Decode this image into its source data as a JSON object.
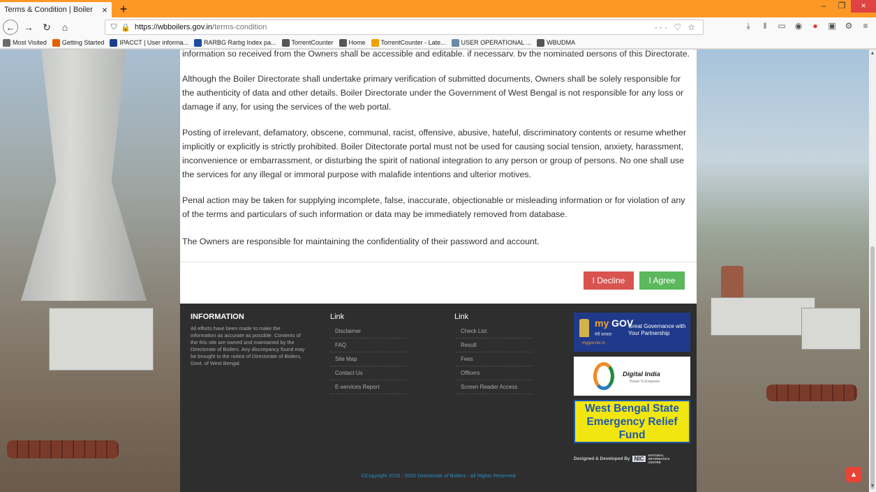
{
  "browser": {
    "tab_title": "Terms & Condition | Boiler",
    "tab_close": "×",
    "new_tab": "+",
    "win_min": "–",
    "win_max": "❐",
    "win_close": "×",
    "url_host": "https://wbboilers.gov.in",
    "url_rest": "/terms-condition",
    "url_actions": "··· ♡ ☆",
    "bookmarks": [
      {
        "label": "Most Visited",
        "icon": "star-icon",
        "color": "#6b6b6b"
      },
      {
        "label": "Getting Started",
        "icon": "firefox-icon",
        "color": "#e66000"
      },
      {
        "label": "IPACCT | User informa...",
        "icon": "ip-icon",
        "color": "#1b3f8b"
      },
      {
        "label": "RARBG Rarbg Index pa...",
        "icon": "r-icon",
        "color": "#1a4fa0"
      },
      {
        "label": "TorrentCounter",
        "icon": "globe-icon",
        "color": "#555"
      },
      {
        "label": "Home",
        "icon": "globe-icon",
        "color": "#555"
      },
      {
        "label": "TorrentCounter - Late...",
        "icon": "torrent-icon",
        "color": "#f2a000"
      },
      {
        "label": "USER OPERATIONAL ...",
        "icon": "image-icon",
        "color": "#6a8aa8"
      },
      {
        "label": "WBUDMA",
        "icon": "globe-icon",
        "color": "#555"
      }
    ]
  },
  "terms": {
    "p0": "information so received from the Owners shall be accessible and editable, if necessary, by the nominated persons of this Directorate.",
    "p1": "Although the Boiler Directorate shall undertake primary verification of submitted documents, Owners shall be solely responsible for the authenticity of data and other details. Boiler Directorate under the Government of West Bengal is not responsible for any loss or damage if any, for using the services of the web portal.",
    "p2": "Posting of irrelevant, defamatory, obscene, communal, racist, offensive, abusive, hateful, discriminatory contents or resume whether implicitly or explicitly is strictly prohibited. Boiler Ditectorate portal must not be used for causing social tension, anxiety, harassment, inconvenience or embarrassment, or disturbing the spirit of national integration to any person or group of persons. No one shall use the services for any illegal or immoral purpose with malafide intentions and ulterior motives.",
    "p3": "Penal action may be taken for supplying incomplete, false, inaccurate, objectionable or misleading information or for violation of any of the terms and particulars of such information or data may be immediately removed from database.",
    "p4": "The Owners are responsible for maintaining the confidentiality of their password and account.",
    "decline_label": "I Decline",
    "agree_label": "I Agree"
  },
  "footer": {
    "info_title": "INFORMATION",
    "info_text": "All efforts have been made to make the information as accurate as possible. Contents of the this site are owned and maintained by the Directorate of Boilers. Any discrepancy found may be brought to the notice of Directorate of Boilers, Govt. of West Bengal.",
    "col1_title": "Link",
    "col1_links": [
      "Disclaimer",
      "FAQ",
      "Site Map",
      "Contact Us",
      "E-services Report"
    ],
    "col2_title": "Link",
    "col2_links": [
      "Check List",
      "Result",
      "Fees",
      "Officers",
      "Screen Reader Access"
    ],
    "mygov_my": "my",
    "mygov_gov": "GOV",
    "mygov_hindi": "मेरी सरकार",
    "mygov_tagline": "Great Governance with Your Partnership",
    "mygov_url": "mygov.nic.in",
    "digital_title": "Digital India",
    "digital_sub": "Power To Empower",
    "relief_text": "West Bengal State Emergency Relief Fund",
    "designed_by": "Designed & Developed By",
    "nic_logo": "NIC",
    "nic_name": "NATIONAL INFORMATICS CENTRE",
    "copyright": "©Copyright 2015 - 2020 Directorate of Boilers - All Rights Reserved"
  },
  "colors": {
    "tabbar": "#fd9827",
    "decline": "#d9534f",
    "agree": "#5cb85c",
    "footer_bg": "#2e2e2e",
    "copyright": "#2a8fc5",
    "scrolltop": "#e84335"
  }
}
